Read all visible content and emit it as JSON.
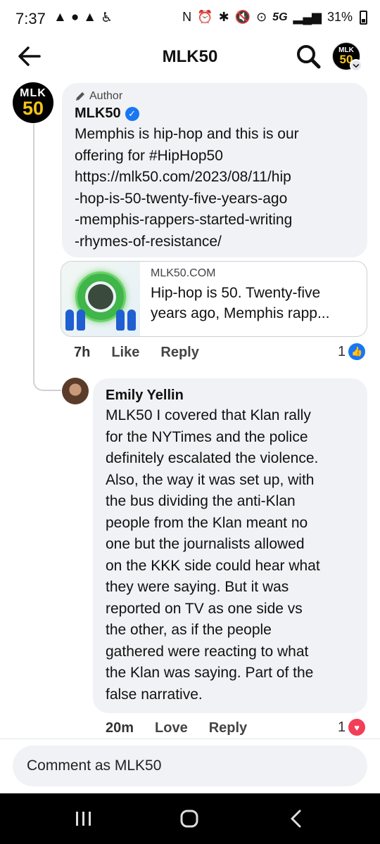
{
  "status_bar": {
    "time": "7:37",
    "left_icons": [
      "navigation-arrow-icon",
      "messenger-icon",
      "navigation-arrow-icon",
      "accessibility-icon"
    ],
    "network": "5G",
    "battery": "31%",
    "right_icons": [
      "nfc-icon",
      "alarm-icon",
      "bluetooth-icon",
      "mute-icon",
      "location-icon",
      "signal-icon",
      "battery-icon"
    ]
  },
  "header": {
    "title": "MLK50",
    "back_icon": "back-arrow-icon",
    "search_icon": "search-icon",
    "profile_logo": {
      "line1": "MLK",
      "line2": "50"
    }
  },
  "comments": [
    {
      "badge": "Author",
      "author": "MLK50",
      "verified": true,
      "avatar_logo": {
        "line1": "MLK",
        "line2": "50"
      },
      "lines": [
        "Memphis is hip-hop and this is our",
        "offering for #HipHop50",
        "https://mlk50.com/2023/08/11/hip",
        "-hop-is-50-twenty-five-years-ago",
        "-memphis-rappers-started-writing",
        "-rhymes-of-resistance/"
      ],
      "link_preview": {
        "domain": "MLK50.COM",
        "title_line1": "Hip-hop is 50. Twenty-five",
        "title_line2": "years ago, Memphis rapp..."
      },
      "time": "7h",
      "like_label": "Like",
      "reply_label": "Reply",
      "reaction_count": "1",
      "reaction_type": "like"
    },
    {
      "author": "Emily Yellin",
      "lines": [
        "MLK50 I covered that Klan rally",
        "for the NYTimes and the police",
        "definitely escalated the violence.",
        "Also, the way it was set up, with",
        "the bus dividing the anti-Klan",
        "people from the Klan meant no",
        "one but the journalists allowed",
        "on the KKK side could hear what",
        "they were saying. But it was",
        "reported on TV as one side vs",
        "the other, as if the people",
        "gathered were reacting to what",
        "the Klan was saying. Part of the",
        "false narrative."
      ],
      "time": "20m",
      "like_label": "Love",
      "reply_label": "Reply",
      "reaction_count": "1",
      "reaction_type": "love"
    }
  ],
  "composer": {
    "placeholder": "Comment as MLK50"
  },
  "nav": {
    "recents_icon": "recent-apps-icon",
    "home_icon": "home-icon",
    "back_icon": "back-icon"
  },
  "colors": {
    "bubble": "#f0f2f5",
    "verified_blue": "#1877f2",
    "love_red": "#f33e58",
    "brand_yellow": "#f5c518"
  }
}
